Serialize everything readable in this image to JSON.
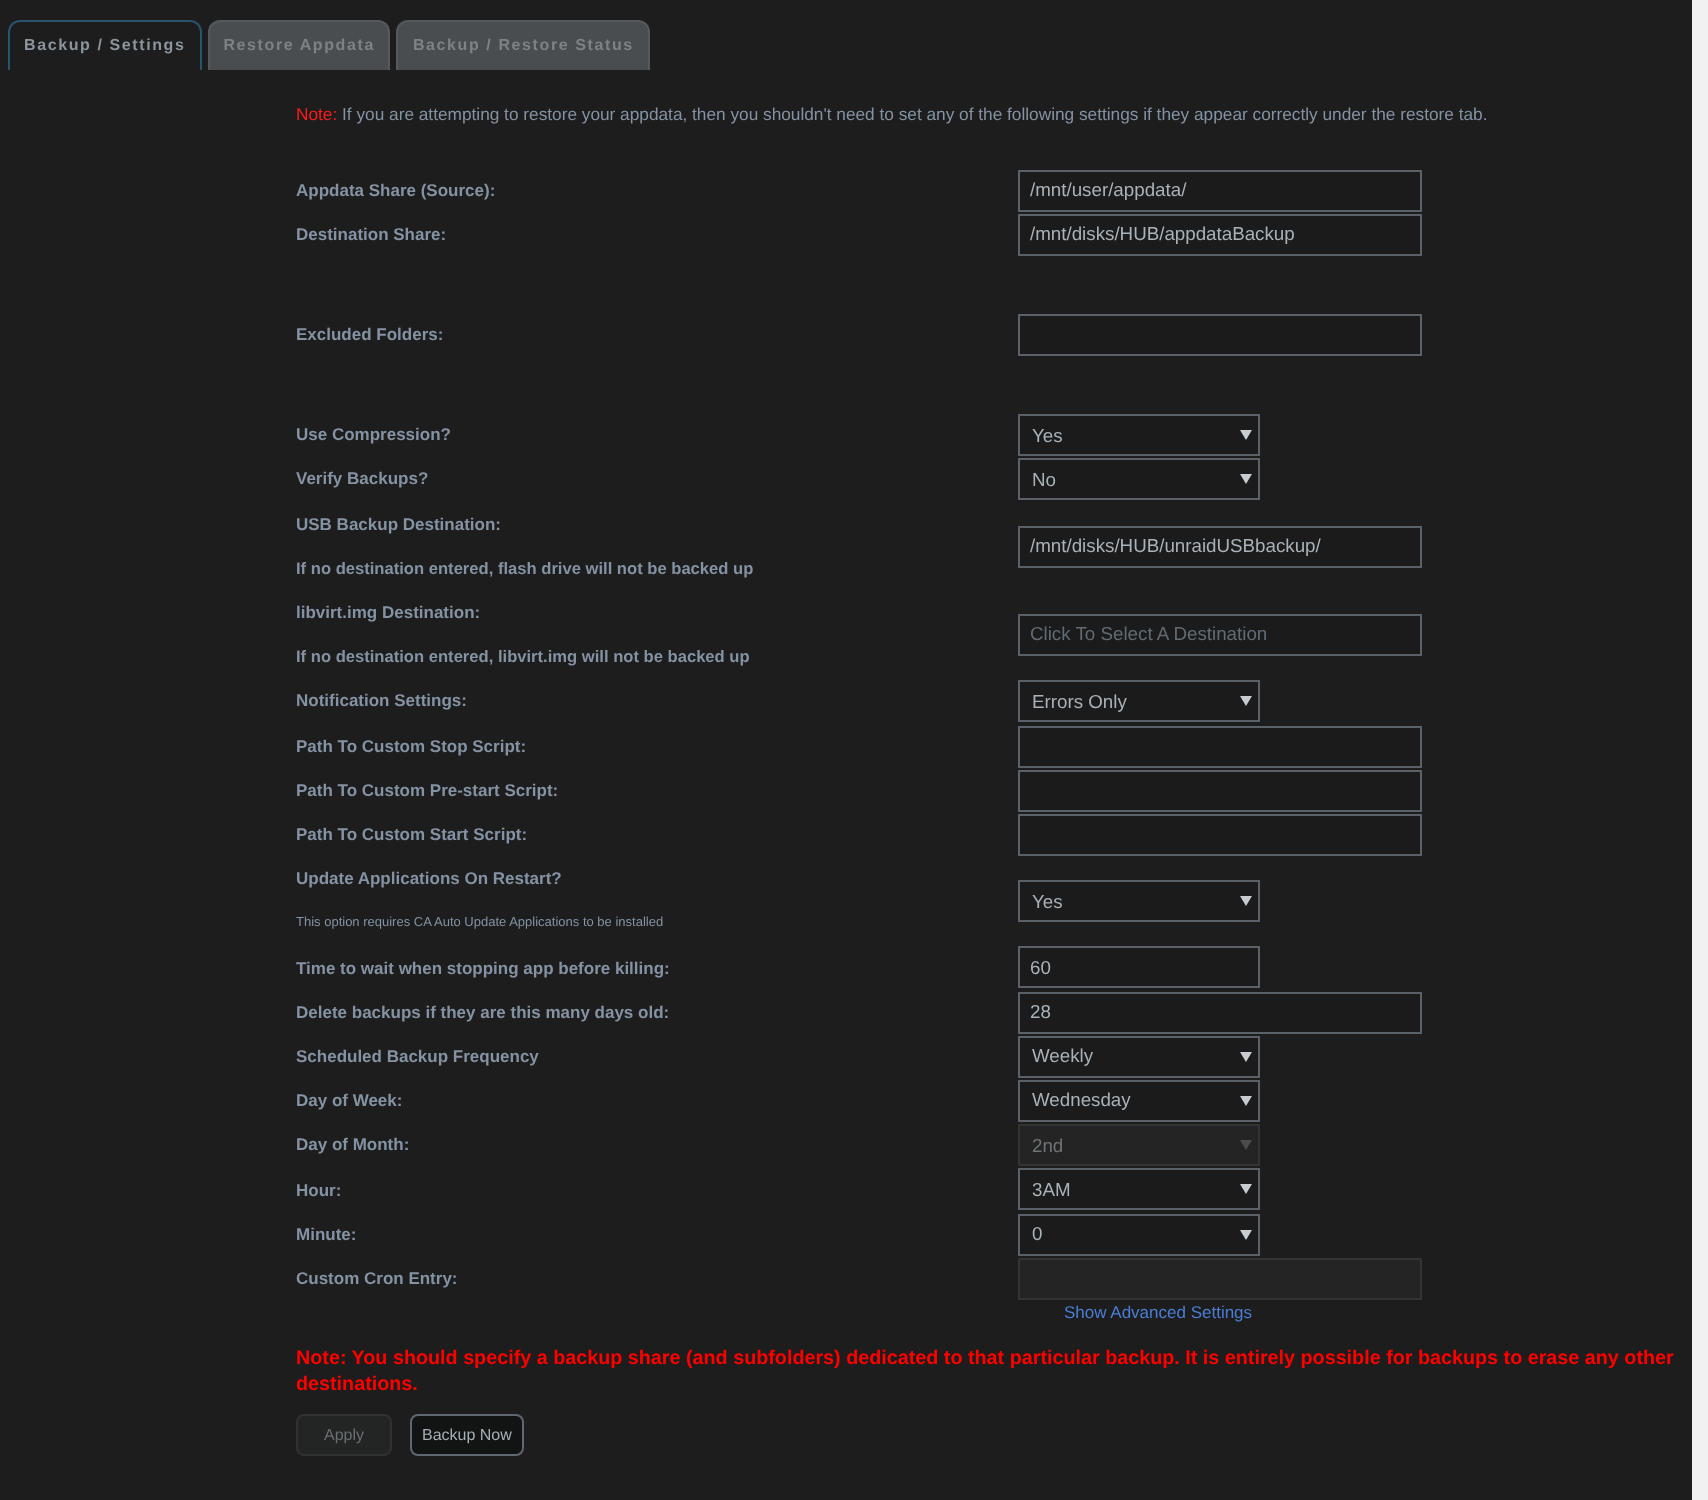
{
  "tabs": [
    {
      "label": "Backup / Settings",
      "selected": true
    },
    {
      "label": "Restore Appdata",
      "selected": false
    },
    {
      "label": "Backup / Restore Status",
      "selected": false
    }
  ],
  "notice": {
    "label": "Note:",
    "text": "If you are attempting to restore your appdata, then you shouldn't need to set any of the following settings if they appear correctly under the restore tab."
  },
  "sections": [
    {
      "fields": [
        {
          "kind": "text",
          "label": "Appdata Share (Source):",
          "value": "/mnt/user/appdata/",
          "disabled": false
        },
        {
          "kind": "text",
          "label": "Destination Share:",
          "value": "/mnt/disks/HUB/appdataBackup",
          "disabled": false
        }
      ]
    },
    {
      "fields": [
        {
          "kind": "text",
          "label": "Excluded Folders:",
          "disabled": false
        }
      ]
    },
    {
      "fields": [
        {
          "kind": "select",
          "label": "Use Compression?",
          "value": "Yes",
          "disabled": false
        },
        {
          "kind": "select",
          "label": "Verify Backups?",
          "value": "No",
          "disabled": false
        },
        {
          "kind": "text",
          "label": "USB Backup Destination:",
          "subtext": "If no destination entered, flash drive will not be backed up",
          "value": "/mnt/disks/HUB/unraidUSBbackup/",
          "disabled": false
        },
        {
          "kind": "text",
          "label": "libvirt.img Destination:",
          "subtext": "If no destination entered, libvirt.img will not be backed up",
          "placeholder": "Click To Select A Destination",
          "disabled": false
        },
        {
          "kind": "select",
          "label": "Notification Settings:",
          "value": "Errors Only",
          "disabled": false
        },
        {
          "kind": "text",
          "label": "Path To Custom Stop Script:",
          "disabled": false
        },
        {
          "kind": "text",
          "label": "Path To Custom Pre-start Script:",
          "disabled": false
        },
        {
          "kind": "text",
          "label": "Path To Custom Start Script:",
          "disabled": false
        },
        {
          "kind": "select",
          "label": "Update Applications On Restart?",
          "footnote": "This option requires CA Auto Update Applications to be installed",
          "value": "Yes",
          "disabled": false
        },
        {
          "kind": "short_text",
          "label": "Time to wait when stopping app before killing:",
          "value": "60",
          "disabled": false
        },
        {
          "kind": "text",
          "label": "Delete backups if they are this many days old:",
          "value": "28",
          "disabled": false
        },
        {
          "kind": "select",
          "label": "Scheduled Backup Frequency",
          "value": "Weekly",
          "disabled": false
        },
        {
          "kind": "select",
          "label": "Day of Week:",
          "value": "Wednesday",
          "disabled": false
        },
        {
          "kind": "select",
          "label": "Day of Month:",
          "value": "2nd",
          "disabled": true
        },
        {
          "kind": "select",
          "label": "Hour:",
          "value": "3AM",
          "disabled": false
        },
        {
          "kind": "select",
          "label": "Minute:",
          "value": "0",
          "disabled": false
        },
        {
          "kind": "text",
          "label": "Custom Cron Entry:",
          "disabled": true
        }
      ]
    }
  ],
  "advanced_link": "Show Advanced Settings",
  "warning": {
    "lines": [
      "Note: You should specify a backup share (and subfolders) dedicated to that particular backup. It is entirely possible for backups to erase any other",
      "destinations."
    ]
  },
  "buttons": [
    {
      "label": "Apply",
      "disabled": true
    },
    {
      "label": "Backup Now",
      "disabled": false
    }
  ]
}
